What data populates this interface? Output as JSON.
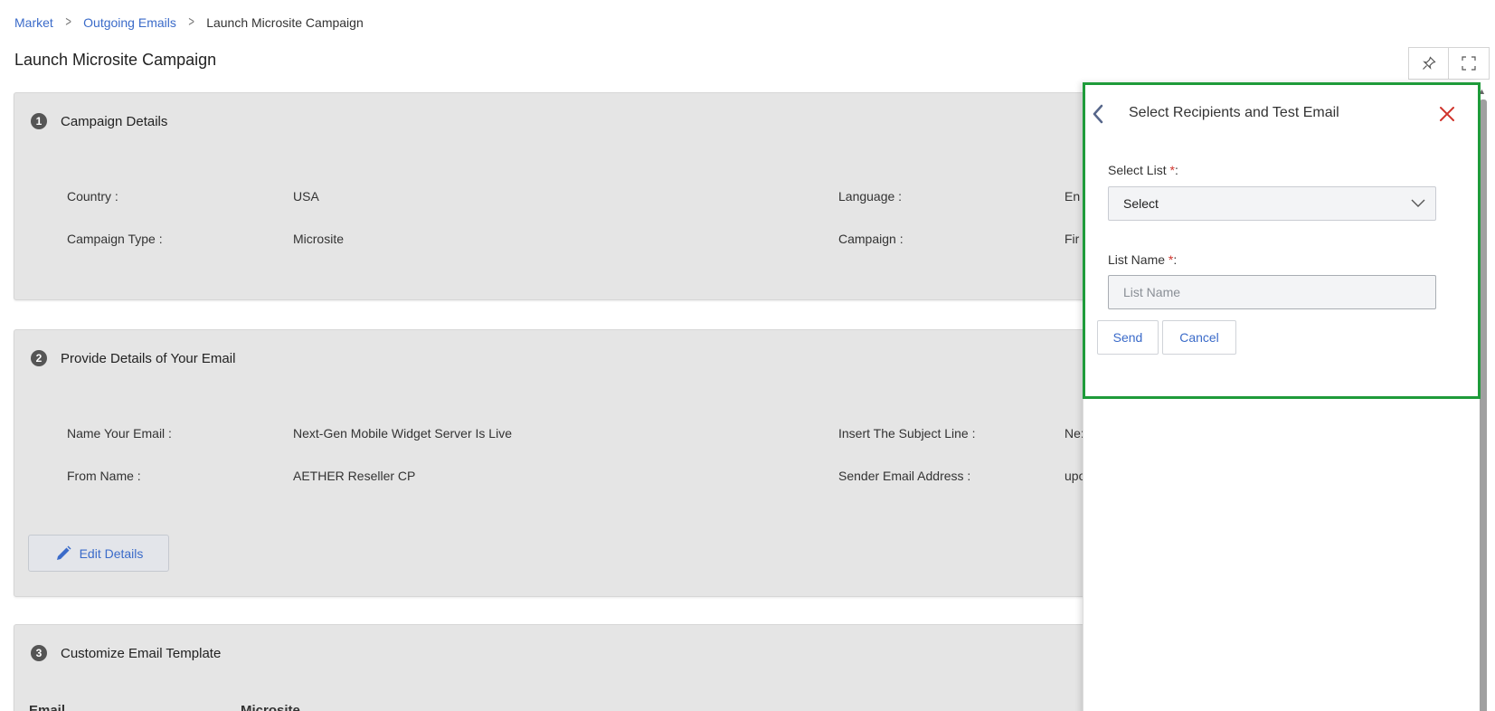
{
  "breadcrumb": {
    "items": [
      "Market",
      "Outgoing Emails"
    ],
    "current": "Launch Microsite Campaign"
  },
  "page": {
    "title": "Launch Microsite Campaign"
  },
  "top_actions": {
    "icons": [
      "pin-icon",
      "fullscreen-icon"
    ]
  },
  "step1": {
    "number": "1",
    "title": "Campaign Details",
    "fields": {
      "country_label": "Country :",
      "country_value": "USA",
      "language_label": "Language :",
      "language_value": "En",
      "campaign_type_label": "Campaign Type :",
      "campaign_type_value": "Microsite",
      "campaign_label": "Campaign :",
      "campaign_value": "Fir"
    }
  },
  "step2": {
    "number": "2",
    "title": "Provide Details of Your Email",
    "fields": {
      "name_label": "Name Your Email :",
      "name_value": "Next-Gen Mobile Widget Server Is Live",
      "subject_label": "Insert The Subject Line :",
      "subject_value": "Ne:",
      "from_label": "From Name :",
      "from_value": "AETHER Reseller CP",
      "sender_label": "Sender Email Address :",
      "sender_value": "upo"
    },
    "edit_label": "Edit Details"
  },
  "step3": {
    "number": "3",
    "title": "Customize Email Template",
    "col_email": "Email",
    "col_microsite": "Microsite"
  },
  "panel": {
    "title": "Select Recipients and Test Email",
    "select_list_label": "Select List",
    "select_list_value": "Select",
    "list_name_label": "List Name",
    "list_name_placeholder": "List Name",
    "required_mark": "*",
    "colon": ":",
    "send_label": "Send",
    "cancel_label": "Cancel"
  },
  "colors": {
    "link": "#3b6bc9",
    "highlight": "#1e9b3a",
    "close": "#d0342c",
    "card_bg": "#e5e5e5"
  }
}
